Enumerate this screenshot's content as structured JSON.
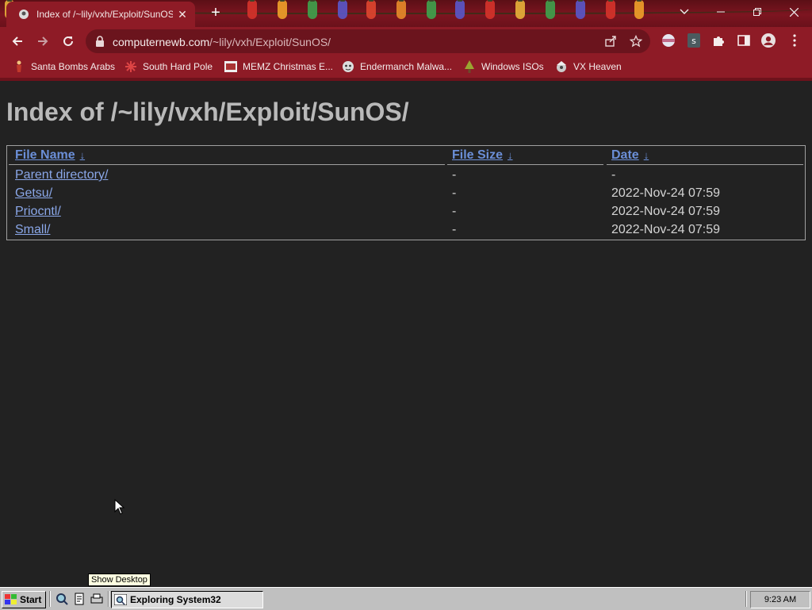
{
  "browser": {
    "tab_title": "Index of /~lily/vxh/Exploit/SunOS/",
    "url_domain": "computernewb.com",
    "url_path": "/~lily/vxh/Exploit/SunOS/",
    "bookmarks": [
      {
        "label": "Santa Bombs Arabs",
        "icon": "figure-icon"
      },
      {
        "label": "South Hard Pole",
        "icon": "snowflake-icon"
      },
      {
        "label": "MEMZ Christmas E...",
        "icon": "image-icon"
      },
      {
        "label": "Endermanch Malwa...",
        "icon": "face-icon"
      },
      {
        "label": "Windows ISOs",
        "icon": "tree-icon"
      },
      {
        "label": "VX Heaven",
        "icon": "hat-icon"
      }
    ]
  },
  "page": {
    "title": "Index of /~lily/vxh/Exploit/SunOS/",
    "columns": [
      "File Name",
      "File Size",
      "Date"
    ],
    "sort_arrow": "↓",
    "rows": [
      {
        "name": "Parent directory/",
        "size": "-",
        "date": "-"
      },
      {
        "name": "Getsu/",
        "size": "-",
        "date": "2022-Nov-24 07:59"
      },
      {
        "name": "Priocntl/",
        "size": "-",
        "date": "2022-Nov-24 07:59"
      },
      {
        "name": "Small/",
        "size": "-",
        "date": "2022-Nov-24 07:59"
      }
    ]
  },
  "taskbar": {
    "start_label": "Start",
    "task_label": "Exploring System32",
    "tooltip": "Show Desktop",
    "clock": "9:23 AM"
  },
  "colors": {
    "chrome": "#8e1b26",
    "page_bg": "#222222",
    "link": "#8aa7e8",
    "header_link": "#6b8fd8"
  }
}
